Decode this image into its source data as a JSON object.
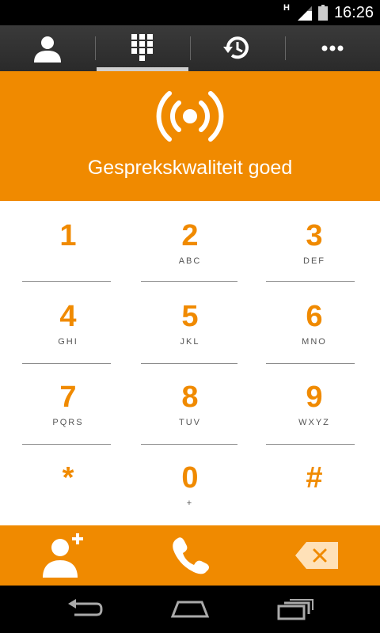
{
  "status_bar": {
    "network_label": "H",
    "time": "16:26"
  },
  "tabs": [
    {
      "icon": "contacts-icon",
      "selected": false
    },
    {
      "icon": "dialpad-icon",
      "selected": true
    },
    {
      "icon": "history-icon",
      "selected": false
    },
    {
      "icon": "more-icon",
      "selected": false
    }
  ],
  "quality": {
    "icon": "signal-broadcast-icon",
    "text": "Gesprekskwaliteit goed"
  },
  "keypad": {
    "keys": [
      {
        "digit": "1",
        "letters": ""
      },
      {
        "digit": "2",
        "letters": "ABC"
      },
      {
        "digit": "3",
        "letters": "DEF"
      },
      {
        "digit": "4",
        "letters": "GHI"
      },
      {
        "digit": "5",
        "letters": "JKL"
      },
      {
        "digit": "6",
        "letters": "MNO"
      },
      {
        "digit": "7",
        "letters": "PQRS"
      },
      {
        "digit": "8",
        "letters": "TUV"
      },
      {
        "digit": "9",
        "letters": "WXYZ"
      },
      {
        "digit": "*",
        "letters": ""
      },
      {
        "digit": "0",
        "letters": "+"
      },
      {
        "digit": "#",
        "letters": ""
      }
    ]
  },
  "actions": {
    "add_contact_icon": "add-contact-icon",
    "call_icon": "phone-call-icon",
    "backspace_icon": "backspace-icon"
  },
  "colors": {
    "accent": "#f08a00"
  }
}
